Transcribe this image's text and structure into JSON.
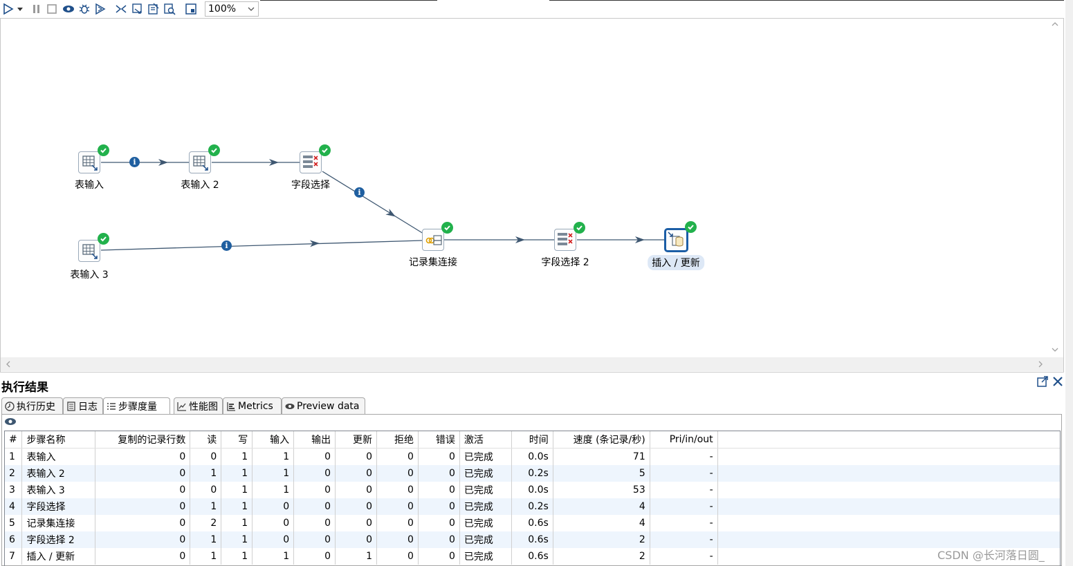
{
  "toolbar": {
    "zoom_value": "100%",
    "buttons": [
      "run-icon",
      "run-options-icon",
      "pause-icon",
      "stop-icon",
      "preview-icon",
      "debug-icon",
      "replay-icon",
      "verify-icon",
      "impact-icon",
      "sql-icon",
      "explore-db-icon",
      "show-results-icon"
    ]
  },
  "canvas": {
    "nodes": [
      {
        "id": "n1",
        "label": "表输入",
        "kind": "table-input",
        "selected": false
      },
      {
        "id": "n2",
        "label": "表输入 2",
        "kind": "table-input",
        "selected": false
      },
      {
        "id": "n3",
        "label": "字段选择",
        "kind": "select-values",
        "selected": false
      },
      {
        "id": "n4",
        "label": "表输入 3",
        "kind": "table-input",
        "selected": false
      },
      {
        "id": "n5",
        "label": "记录集连接",
        "kind": "merge-join",
        "selected": false
      },
      {
        "id": "n6",
        "label": "字段选择 2",
        "kind": "select-values",
        "selected": false
      },
      {
        "id": "n7",
        "label": "插入 / 更新",
        "kind": "insert-update",
        "selected": true
      }
    ],
    "hop_info_symbol": "i"
  },
  "results": {
    "title": "执行结果",
    "tabs": [
      {
        "label": "执行历史",
        "icon": "history-icon"
      },
      {
        "label": "日志",
        "icon": "log-icon"
      },
      {
        "label": "步骤度量",
        "icon": "step-metrics-icon",
        "active": true
      },
      {
        "label": "性能图",
        "icon": "performance-chart-icon"
      },
      {
        "label": "Metrics",
        "icon": "metrics-icon"
      },
      {
        "label": "Preview data",
        "icon": "preview-icon"
      }
    ],
    "table": {
      "headers": [
        "#",
        "步骤名称",
        "复制的记录行数",
        "读",
        "写",
        "输入",
        "输出",
        "更新",
        "拒绝",
        "错误",
        "激活",
        "时间",
        "速度 (条记录/秒)",
        "Pri/in/out"
      ],
      "rows": [
        [
          "1",
          "表输入",
          "0",
          "0",
          "1",
          "1",
          "0",
          "0",
          "0",
          "0",
          "已完成",
          "0.0s",
          "71",
          "-"
        ],
        [
          "2",
          "表输入 2",
          "0",
          "1",
          "1",
          "1",
          "0",
          "0",
          "0",
          "0",
          "已完成",
          "0.2s",
          "5",
          "-"
        ],
        [
          "3",
          "表输入 3",
          "0",
          "0",
          "1",
          "1",
          "0",
          "0",
          "0",
          "0",
          "已完成",
          "0.0s",
          "53",
          "-"
        ],
        [
          "4",
          "字段选择",
          "0",
          "1",
          "1",
          "0",
          "0",
          "0",
          "0",
          "0",
          "已完成",
          "0.2s",
          "4",
          "-"
        ],
        [
          "5",
          "记录集连接",
          "0",
          "2",
          "1",
          "0",
          "0",
          "0",
          "0",
          "0",
          "已完成",
          "0.6s",
          "4",
          "-"
        ],
        [
          "6",
          "字段选择 2",
          "0",
          "1",
          "1",
          "0",
          "0",
          "0",
          "0",
          "0",
          "已完成",
          "0.6s",
          "2",
          "-"
        ],
        [
          "7",
          "插入 / 更新",
          "0",
          "1",
          "1",
          "1",
          "0",
          "1",
          "0",
          "0",
          "已完成",
          "0.6s",
          "2",
          "-"
        ]
      ]
    }
  },
  "watermark": "CSDN @长河落日圆_",
  "colors": {
    "accent": "#1f5fa0",
    "success": "#22b14c",
    "hop": "#3e5771",
    "row_alt": "#eef5fd"
  }
}
